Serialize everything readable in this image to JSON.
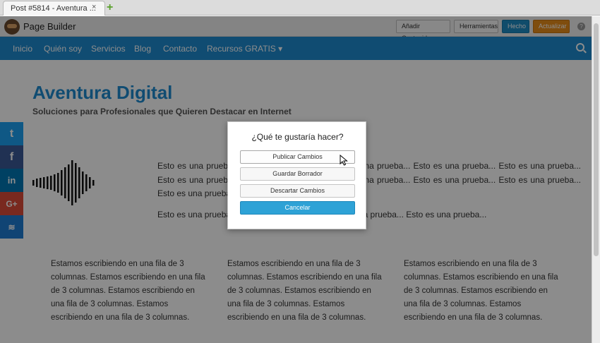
{
  "browser": {
    "tab_title": "Post #5814 - Aventura ...",
    "tab_close": "×",
    "new_tab": "+"
  },
  "builder": {
    "title": "Page Builder",
    "add_content": "Añadir Contenido",
    "tools": "Herramientas",
    "done": "Hecho",
    "update": "Actualizar",
    "help": "?"
  },
  "nav": {
    "items": [
      "Inicio",
      "Quién soy",
      "Servicios",
      "Blog",
      "Contacto",
      "Recursos GRATIS ▾"
    ]
  },
  "site": {
    "title": "Aventura Digital",
    "tagline": "Soluciones para Profesionales que Quieren Destacar en Internet",
    "para1": "Esto es una prueba... Esto es una prueba... Esto es una prueba... Esto es una prueba... Esto es una prueba... Esto es una prueba... Esto es una prueba... Esto es una prueba... Esto es una prueba... Esto es una prueba... Esto es una prueba... Esto es una prueba...",
    "para2": "Esto es una prueba... Esto es una prueba... Esto es una prueba... Esto es una prueba...",
    "col_text": "Estamos escribiendo en una fila de 3 columnas. Estamos escribiendo en una fila de 3 columnas. Estamos escribiendo en una fila de 3 columnas. Estamos escribiendo en una fila de 3 columnas."
  },
  "social": {
    "twitter": "t",
    "facebook": "f",
    "linkedin": "in",
    "googleplus": "G+",
    "sumome": "≋"
  },
  "modal": {
    "title": "¿Qué te gustaría hacer?",
    "publish": "Publicar Cambios",
    "draft": "Guardar Borrador",
    "discard": "Descartar Cambios",
    "cancel": "Cancelar"
  }
}
